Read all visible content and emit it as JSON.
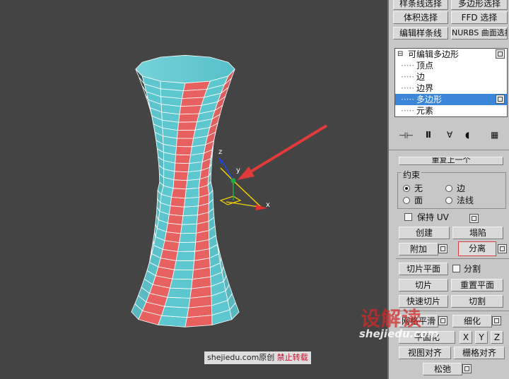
{
  "panel_top": {
    "btn1": "样条线选择",
    "btn2": "多边形选择",
    "btn3": "体积选择",
    "btn4": "FFD 选择",
    "btn5": "编辑样条线",
    "btn6": "NURBS 曲面选择"
  },
  "stack": {
    "root": "可编辑多边形",
    "items": [
      "顶点",
      "边",
      "边界",
      "多边形",
      "元素"
    ],
    "selected_index": 3
  },
  "rollout": {
    "cut_top": "重复上一个",
    "constraint_title": "约束",
    "constraint_options": [
      "无",
      "边",
      "面",
      "法线"
    ],
    "preserve_uv": "保持 UV",
    "create": "创建",
    "collapse": "塌陷",
    "attach": "附加",
    "detach": "分离",
    "slice_plane": "切片平面",
    "split": "分割",
    "slice": "切片",
    "reset_plane": "重置平面",
    "quickslice": "快速切片",
    "cut": "切割",
    "meshsmooth": "网格平滑",
    "tessellate": "细化",
    "make_planar": "平面化",
    "x": "X",
    "y": "Y",
    "z": "Z",
    "view_align": "视图对齐",
    "grid_align": "栅格对齐",
    "relax": "松弛"
  },
  "viewport": {
    "axis_x": "x",
    "axis_y": "y",
    "axis_z": "z"
  },
  "watermark": {
    "logo": "设解读",
    "logo_sub": "shejiedu.com",
    "site": "shejiedu.com原创",
    "notice": "禁止转载"
  },
  "colors": {
    "viewport_bg": "#444444",
    "mesh_cyan": "#5cc7cf",
    "selected_face": "#e86161",
    "highlight": "#3b86d9",
    "arrow": "#e03a3a"
  }
}
